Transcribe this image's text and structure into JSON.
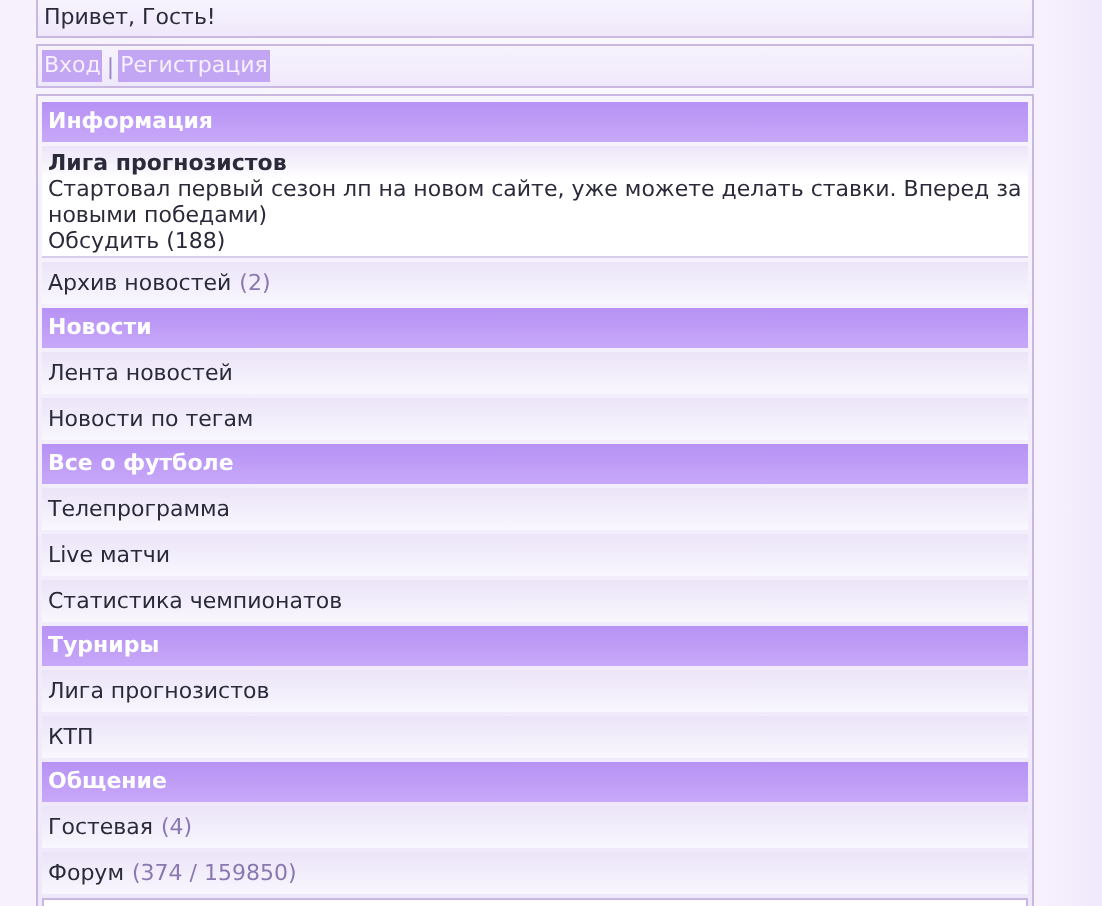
{
  "greeting": "Привет, Гость!",
  "auth_links": [
    {
      "label": "Вход"
    },
    {
      "label": "Регистрация"
    }
  ],
  "auth_separator": "|",
  "sections": [
    {
      "title": "Информация",
      "items": [
        {
          "kind": "news",
          "title": "Лига прогнозистов",
          "text": "Стартовал первый сезон лп на новом сайте, уже можете делать ставки. Вперед за новыми победами)",
          "discuss": "Обсудить (188)"
        },
        {
          "kind": "link",
          "label": "Архив новостей",
          "count": "(2)"
        }
      ]
    },
    {
      "title": "Новости",
      "items": [
        {
          "kind": "link",
          "label": "Лента новостей"
        },
        {
          "kind": "link",
          "label": "Новости по тегам"
        }
      ]
    },
    {
      "title": "Все о футболе",
      "items": [
        {
          "kind": "link",
          "label": "Телепрограмма"
        },
        {
          "kind": "link",
          "label": "Live матчи"
        },
        {
          "kind": "link",
          "label": "Статистика чемпионатов"
        }
      ]
    },
    {
      "title": "Турниры",
      "items": [
        {
          "kind": "link",
          "label": "Лига прогнозистов"
        },
        {
          "kind": "link",
          "label": "КТП"
        }
      ]
    },
    {
      "title": "Общение",
      "items": [
        {
          "kind": "link",
          "label": "Гостевая",
          "count": "(4)"
        },
        {
          "kind": "link",
          "label": "Форум",
          "count": "(374 / 159850)"
        }
      ]
    }
  ]
}
